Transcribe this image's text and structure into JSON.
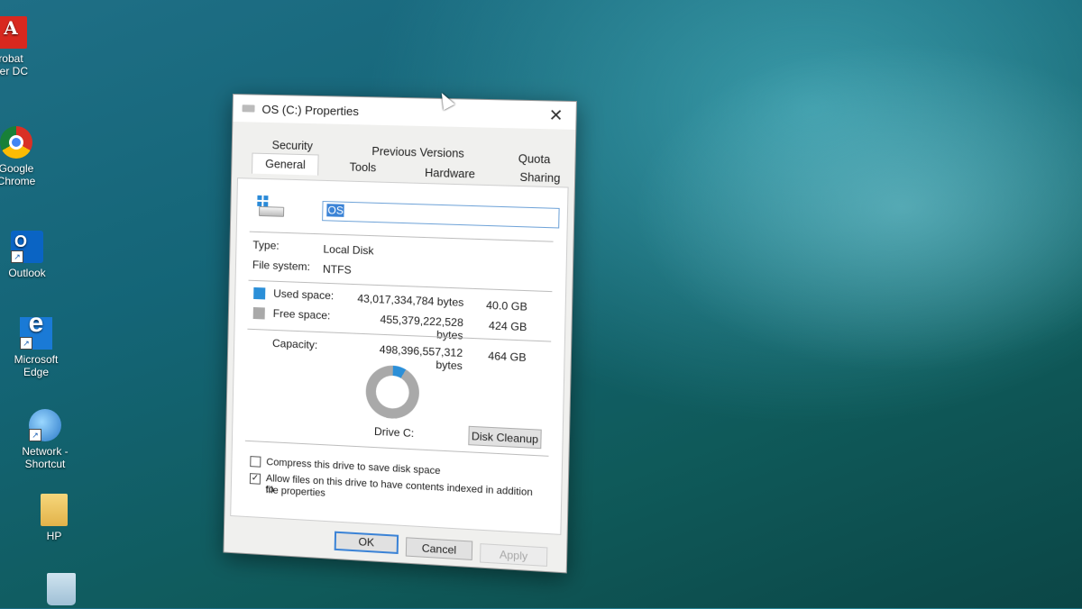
{
  "desktop_icons": [
    {
      "name": "acrobat",
      "line1": "robat",
      "line2": "der DC"
    },
    {
      "name": "chrome",
      "line1": "Google",
      "line2": "Chrome"
    },
    {
      "name": "outlook",
      "line1": "Outlook",
      "line2": ""
    },
    {
      "name": "edge",
      "line1": "Microsoft",
      "line2": "Edge"
    },
    {
      "name": "network",
      "line1": "Network -",
      "line2": "Shortcut"
    },
    {
      "name": "hp",
      "line1": "HP",
      "line2": ""
    }
  ],
  "dialog": {
    "title": "OS (C:) Properties",
    "close_glyph": "✕",
    "tabs": {
      "security": "Security",
      "previous_versions": "Previous Versions",
      "quota": "Quota",
      "general": "General",
      "tools": "Tools",
      "hardware": "Hardware",
      "sharing": "Sharing"
    },
    "volume_name": "OS",
    "type_label": "Type:",
    "type_value": "Local Disk",
    "fs_label": "File system:",
    "fs_value": "NTFS",
    "used_label": "Used space:",
    "used_bytes": "43,017,334,784 bytes",
    "used_gb": "40.0 GB",
    "free_label": "Free space:",
    "free_bytes": "455,379,222,528 bytes",
    "free_gb": "424 GB",
    "capacity_label": "Capacity:",
    "capacity_bytes": "498,396,557,312 bytes",
    "capacity_gb": "464 GB",
    "used_fraction": 0.0807,
    "drive_label": "Drive C:",
    "disk_cleanup": "Disk Cleanup",
    "compress_label": "Compress this drive to save disk space",
    "compress_checked": false,
    "index_label": "Allow files on this drive to have contents indexed in addition to",
    "index_label2": "file properties",
    "index_checked": true,
    "ok": "OK",
    "cancel": "Cancel",
    "apply": "Apply"
  },
  "colors": {
    "used": "#2b8fd8",
    "free": "#a9a9a9",
    "accent": "#3b83d6"
  }
}
